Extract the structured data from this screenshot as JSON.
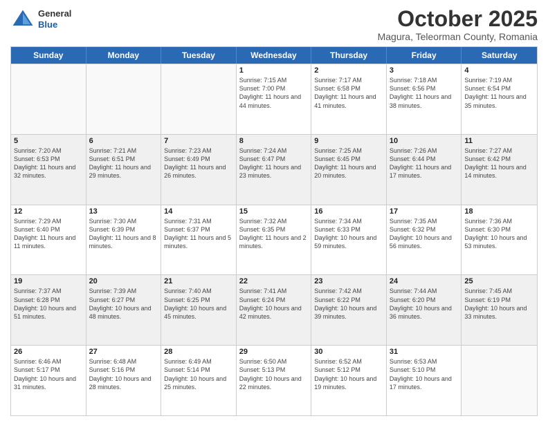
{
  "logo": {
    "general": "General",
    "blue": "Blue"
  },
  "header": {
    "month": "October 2025",
    "location": "Magura, Teleorman County, Romania"
  },
  "days_of_week": [
    "Sunday",
    "Monday",
    "Tuesday",
    "Wednesday",
    "Thursday",
    "Friday",
    "Saturday"
  ],
  "weeks": [
    [
      {
        "day": "",
        "info": "",
        "empty": true
      },
      {
        "day": "",
        "info": "",
        "empty": true
      },
      {
        "day": "",
        "info": "",
        "empty": true
      },
      {
        "day": "1",
        "info": "Sunrise: 7:15 AM\nSunset: 7:00 PM\nDaylight: 11 hours and 44 minutes.",
        "empty": false
      },
      {
        "day": "2",
        "info": "Sunrise: 7:17 AM\nSunset: 6:58 PM\nDaylight: 11 hours and 41 minutes.",
        "empty": false
      },
      {
        "day": "3",
        "info": "Sunrise: 7:18 AM\nSunset: 6:56 PM\nDaylight: 11 hours and 38 minutes.",
        "empty": false
      },
      {
        "day": "4",
        "info": "Sunrise: 7:19 AM\nSunset: 6:54 PM\nDaylight: 11 hours and 35 minutes.",
        "empty": false
      }
    ],
    [
      {
        "day": "5",
        "info": "Sunrise: 7:20 AM\nSunset: 6:53 PM\nDaylight: 11 hours and 32 minutes.",
        "empty": false
      },
      {
        "day": "6",
        "info": "Sunrise: 7:21 AM\nSunset: 6:51 PM\nDaylight: 11 hours and 29 minutes.",
        "empty": false
      },
      {
        "day": "7",
        "info": "Sunrise: 7:23 AM\nSunset: 6:49 PM\nDaylight: 11 hours and 26 minutes.",
        "empty": false
      },
      {
        "day": "8",
        "info": "Sunrise: 7:24 AM\nSunset: 6:47 PM\nDaylight: 11 hours and 23 minutes.",
        "empty": false
      },
      {
        "day": "9",
        "info": "Sunrise: 7:25 AM\nSunset: 6:45 PM\nDaylight: 11 hours and 20 minutes.",
        "empty": false
      },
      {
        "day": "10",
        "info": "Sunrise: 7:26 AM\nSunset: 6:44 PM\nDaylight: 11 hours and 17 minutes.",
        "empty": false
      },
      {
        "day": "11",
        "info": "Sunrise: 7:27 AM\nSunset: 6:42 PM\nDaylight: 11 hours and 14 minutes.",
        "empty": false
      }
    ],
    [
      {
        "day": "12",
        "info": "Sunrise: 7:29 AM\nSunset: 6:40 PM\nDaylight: 11 hours and 11 minutes.",
        "empty": false
      },
      {
        "day": "13",
        "info": "Sunrise: 7:30 AM\nSunset: 6:39 PM\nDaylight: 11 hours and 8 minutes.",
        "empty": false
      },
      {
        "day": "14",
        "info": "Sunrise: 7:31 AM\nSunset: 6:37 PM\nDaylight: 11 hours and 5 minutes.",
        "empty": false
      },
      {
        "day": "15",
        "info": "Sunrise: 7:32 AM\nSunset: 6:35 PM\nDaylight: 11 hours and 2 minutes.",
        "empty": false
      },
      {
        "day": "16",
        "info": "Sunrise: 7:34 AM\nSunset: 6:33 PM\nDaylight: 10 hours and 59 minutes.",
        "empty": false
      },
      {
        "day": "17",
        "info": "Sunrise: 7:35 AM\nSunset: 6:32 PM\nDaylight: 10 hours and 56 minutes.",
        "empty": false
      },
      {
        "day": "18",
        "info": "Sunrise: 7:36 AM\nSunset: 6:30 PM\nDaylight: 10 hours and 53 minutes.",
        "empty": false
      }
    ],
    [
      {
        "day": "19",
        "info": "Sunrise: 7:37 AM\nSunset: 6:28 PM\nDaylight: 10 hours and 51 minutes.",
        "empty": false
      },
      {
        "day": "20",
        "info": "Sunrise: 7:39 AM\nSunset: 6:27 PM\nDaylight: 10 hours and 48 minutes.",
        "empty": false
      },
      {
        "day": "21",
        "info": "Sunrise: 7:40 AM\nSunset: 6:25 PM\nDaylight: 10 hours and 45 minutes.",
        "empty": false
      },
      {
        "day": "22",
        "info": "Sunrise: 7:41 AM\nSunset: 6:24 PM\nDaylight: 10 hours and 42 minutes.",
        "empty": false
      },
      {
        "day": "23",
        "info": "Sunrise: 7:42 AM\nSunset: 6:22 PM\nDaylight: 10 hours and 39 minutes.",
        "empty": false
      },
      {
        "day": "24",
        "info": "Sunrise: 7:44 AM\nSunset: 6:20 PM\nDaylight: 10 hours and 36 minutes.",
        "empty": false
      },
      {
        "day": "25",
        "info": "Sunrise: 7:45 AM\nSunset: 6:19 PM\nDaylight: 10 hours and 33 minutes.",
        "empty": false
      }
    ],
    [
      {
        "day": "26",
        "info": "Sunrise: 6:46 AM\nSunset: 5:17 PM\nDaylight: 10 hours and 31 minutes.",
        "empty": false
      },
      {
        "day": "27",
        "info": "Sunrise: 6:48 AM\nSunset: 5:16 PM\nDaylight: 10 hours and 28 minutes.",
        "empty": false
      },
      {
        "day": "28",
        "info": "Sunrise: 6:49 AM\nSunset: 5:14 PM\nDaylight: 10 hours and 25 minutes.",
        "empty": false
      },
      {
        "day": "29",
        "info": "Sunrise: 6:50 AM\nSunset: 5:13 PM\nDaylight: 10 hours and 22 minutes.",
        "empty": false
      },
      {
        "day": "30",
        "info": "Sunrise: 6:52 AM\nSunset: 5:12 PM\nDaylight: 10 hours and 19 minutes.",
        "empty": false
      },
      {
        "day": "31",
        "info": "Sunrise: 6:53 AM\nSunset: 5:10 PM\nDaylight: 10 hours and 17 minutes.",
        "empty": false
      },
      {
        "day": "",
        "info": "",
        "empty": true
      }
    ]
  ]
}
